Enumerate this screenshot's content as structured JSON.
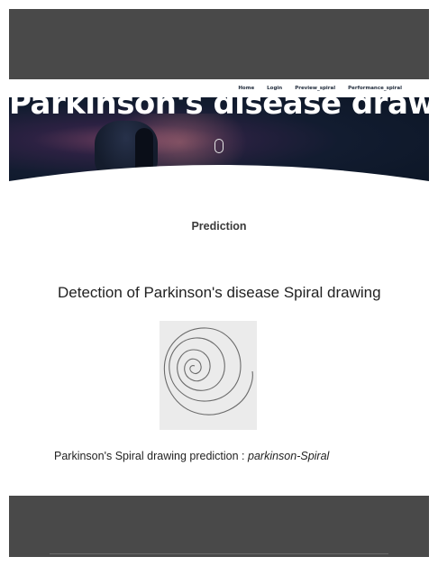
{
  "nav": {
    "items": [
      {
        "label": "Home"
      },
      {
        "label": "Login"
      },
      {
        "label": "Preview_spiral"
      },
      {
        "label": "Performance_spiral"
      }
    ]
  },
  "hero": {
    "title": "Parkinson's disease drawing"
  },
  "main": {
    "section_title": "Prediction",
    "detection_title": "Detection of Parkinson's disease Spiral drawing",
    "result_label": "Parkinson's Spiral drawing prediction : ",
    "result_value": "parkinson-Spiral"
  },
  "colors": {
    "top_bar": "#494949",
    "footer": "#494949",
    "hero_bg": "#0b1524",
    "text": "#222222"
  },
  "icons": {
    "scroll": "scroll-down-icon"
  }
}
